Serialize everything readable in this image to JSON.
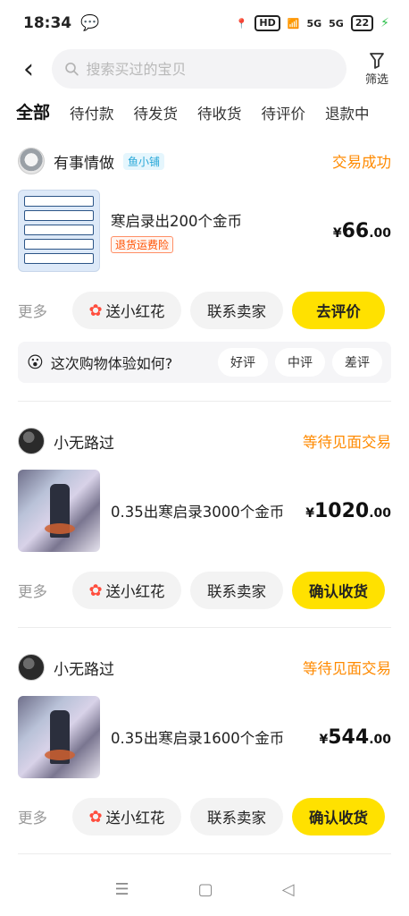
{
  "status_bar": {
    "time": "18:34",
    "network": "HD",
    "signal1": "5G",
    "signal2": "5G",
    "battery": "22"
  },
  "header": {
    "search_placeholder": "搜索买过的宝贝",
    "filter_label": "筛选"
  },
  "tabs": [
    {
      "label": "全部",
      "active": true
    },
    {
      "label": "待付款"
    },
    {
      "label": "待发货"
    },
    {
      "label": "待收货"
    },
    {
      "label": "待评价"
    },
    {
      "label": "退款中"
    }
  ],
  "orders": [
    {
      "seller": "有事情做",
      "badge": "鱼小铺",
      "status": "交易成功",
      "title": "寒启录出200个金币",
      "tag": "退货运费险",
      "price_symbol": "¥",
      "price_int": "66",
      "price_dec": ".00",
      "more": "更多",
      "flower": "送小红花",
      "contact": "联系卖家",
      "primary": "去评价",
      "rating": {
        "question": "这次购物体验如何?",
        "options": [
          "好评",
          "中评",
          "差评"
        ]
      }
    },
    {
      "seller": "小无路过",
      "status": "等待见面交易",
      "title": "0.35出寒启录3000个金币",
      "price_symbol": "¥",
      "price_int": "1020",
      "price_dec": ".00",
      "more": "更多",
      "flower": "送小红花",
      "contact": "联系卖家",
      "primary": "确认收货"
    },
    {
      "seller": "小无路过",
      "status": "等待见面交易",
      "title": "0.35出寒启录1600个金币",
      "price_symbol": "¥",
      "price_int": "544",
      "price_dec": ".00",
      "more": "更多",
      "flower": "送小红花",
      "contact": "联系卖家",
      "primary": "确认收货"
    }
  ],
  "nav": {
    "menu_icon": "☰",
    "home_icon": "▢",
    "back_icon": "◁"
  },
  "colors": {
    "accent": "#ffe100",
    "status": "#ff8a00"
  }
}
